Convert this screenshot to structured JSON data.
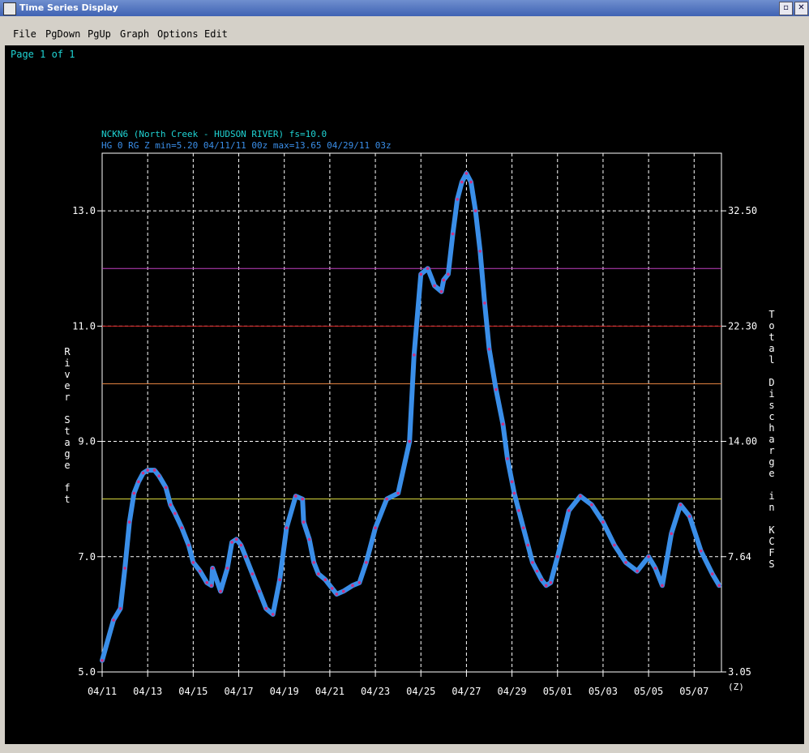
{
  "window": {
    "title": "Time Series Display"
  },
  "menu": [
    "File",
    "PgDown",
    "PgUp",
    "Graph",
    "Options",
    "Edit"
  ],
  "page_info": "Page 1 of 1",
  "chart_data": {
    "type": "line",
    "header_line1": "NCKN6 (North Creek - HUDSON RIVER) fs=10.0",
    "header_line2": "HG 0 RG Z min=5.20 04/11/11 00z max=13.65 04/29/11 03z",
    "ylabel": "River Stage ft",
    "y2label": "Total Discharge in KCFS",
    "xlabel": "(Z)",
    "ylim": [
      5.0,
      14.0
    ],
    "xlim_days": [
      0,
      27.2
    ],
    "y_ticks": [
      "5.0",
      "7.0",
      "9.0",
      "11.0",
      "13.0"
    ],
    "y2_ticks": [
      "3.05",
      "7.64",
      "14.00",
      "22.30",
      "32.50"
    ],
    "x_ticks": [
      "04/11",
      "04/13",
      "04/15",
      "04/17",
      "04/19",
      "04/21",
      "04/23",
      "04/25",
      "04/27",
      "04/29",
      "05/01",
      "05/03",
      "05/05",
      "05/07"
    ],
    "thresholds": [
      {
        "value": 12.0,
        "color": "#c040c0"
      },
      {
        "value": 11.0,
        "color": "#d02020"
      },
      {
        "value": 10.0,
        "color": "#e08040"
      },
      {
        "value": 8.0,
        "color": "#e0e040"
      }
    ],
    "series": [
      {
        "observed": true,
        "color": "#3a8ee8",
        "x": [
          0,
          0.5,
          0.8,
          1.0,
          1.2,
          1.4,
          1.6,
          1.8,
          2.0,
          2.3,
          2.5,
          2.8,
          3.0,
          3.2,
          3.5,
          3.8,
          4.0,
          4.3,
          4.6,
          4.8,
          4.85,
          5.2,
          5.5,
          5.7,
          5.9,
          6.1,
          6.3,
          6.6,
          6.9,
          7.2,
          7.5,
          7.8,
          8.1,
          8.5,
          8.8,
          8.85,
          9.1,
          9.3,
          9.5,
          9.8,
          10.1,
          10.3,
          10.6,
          11.0,
          11.3,
          11.6,
          12.0,
          12.5,
          13.0,
          13.5,
          13.7,
          14.0,
          14.3,
          14.6,
          14.9,
          15.0,
          15.2,
          15.4,
          15.6,
          15.8,
          16.0,
          16.2,
          16.4,
          16.6,
          16.8,
          17.0,
          17.3,
          17.6,
          17.8,
          18.0,
          18.1,
          18.3,
          18.5,
          18.7,
          18.9,
          19.1,
          19.3,
          19.5,
          19.7,
          20.0,
          20.5,
          21.0,
          21.5,
          22.0,
          22.5,
          23.0,
          23.5,
          24.0,
          24.3,
          24.6,
          25.0,
          25.4,
          25.8,
          26.3,
          26.8,
          27.1
        ],
        "y": [
          5.2,
          5.9,
          6.1,
          6.8,
          7.6,
          8.1,
          8.3,
          8.45,
          8.5,
          8.5,
          8.4,
          8.2,
          7.9,
          7.75,
          7.5,
          7.2,
          6.9,
          6.75,
          6.55,
          6.5,
          6.8,
          6.4,
          6.8,
          7.25,
          7.3,
          7.2,
          7.0,
          6.7,
          6.4,
          6.1,
          6.0,
          6.6,
          7.5,
          8.05,
          8.0,
          7.6,
          7.3,
          6.9,
          6.7,
          6.6,
          6.45,
          6.35,
          6.4,
          6.5,
          6.55,
          6.9,
          7.5,
          8.0,
          8.1,
          9.0,
          10.5,
          11.9,
          12.0,
          11.7,
          11.6,
          11.8,
          11.9,
          12.6,
          13.2,
          13.5,
          13.65,
          13.5,
          13.0,
          12.3,
          11.4,
          10.6,
          9.9,
          9.3,
          8.7,
          8.3,
          8.1,
          7.8,
          7.5,
          7.2,
          6.9,
          6.75,
          6.6,
          6.5,
          6.55,
          7.0,
          7.8,
          8.05,
          7.9,
          7.6,
          7.2,
          6.9,
          6.75,
          7.0,
          6.8,
          6.5,
          7.4,
          7.9,
          7.7,
          7.1,
          6.7,
          6.5
        ]
      }
    ]
  }
}
